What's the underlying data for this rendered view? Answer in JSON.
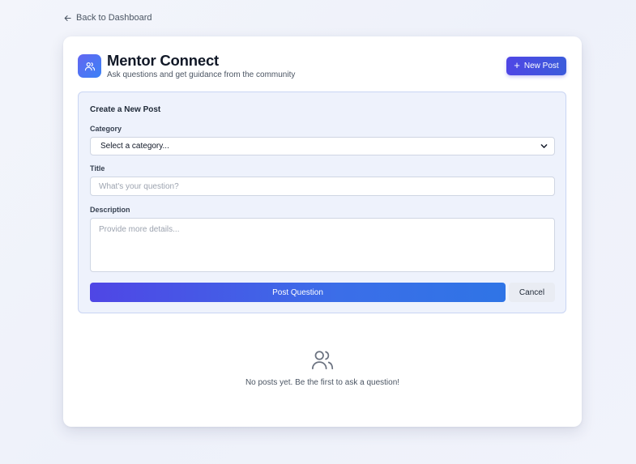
{
  "nav": {
    "back_label": "Back to Dashboard",
    "back_icon": "arrow-left-icon"
  },
  "header": {
    "icon": "users-icon",
    "title": "Mentor Connect",
    "subtitle": "Ask questions and get guidance from the community",
    "new_post_label": "New Post",
    "new_post_icon": "plus-icon"
  },
  "form": {
    "heading": "Create a New Post",
    "category_label": "Category",
    "category_value": "Select a category...",
    "title_label": "Title",
    "title_placeholder": "What's your question?",
    "description_label": "Description",
    "description_placeholder": "Provide more details...",
    "submit_label": "Post Question",
    "cancel_label": "Cancel"
  },
  "empty_state": {
    "icon": "users-icon",
    "message": "No posts yet. Be the first to ask a question!"
  },
  "colors": {
    "accent": "#4f46e5",
    "accent_blue": "#3b82f6",
    "panel_bg": "#eef2fc",
    "panel_border": "#c9d5f3"
  }
}
